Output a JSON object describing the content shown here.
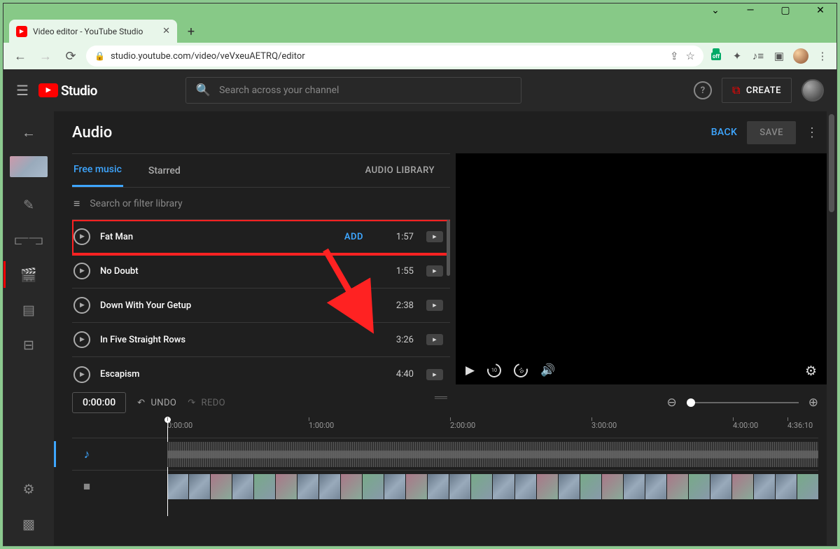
{
  "browser": {
    "tab_title": "Video editor - YouTube Studio",
    "url": "studio.youtube.com/video/veVxeuAETRQ/editor"
  },
  "studio": {
    "logo_text": "Studio",
    "search_placeholder": "Search across your channel",
    "create_label": "CREATE"
  },
  "page": {
    "title": "Audio",
    "back_label": "BACK",
    "save_label": "SAVE"
  },
  "tabs": {
    "free_music": "Free music",
    "starred": "Starred",
    "audio_library": "AUDIO LIBRARY"
  },
  "filter": {
    "placeholder": "Search or filter library"
  },
  "tracks": [
    {
      "title": "Fat Man",
      "duration": "1:57",
      "add": "ADD",
      "highlighted": true
    },
    {
      "title": "No Doubt",
      "duration": "1:55"
    },
    {
      "title": "Down With Your Getup",
      "duration": "2:38"
    },
    {
      "title": "In Five Straight Rows",
      "duration": "3:26"
    },
    {
      "title": "Escapism",
      "duration": "4:40"
    }
  ],
  "timeline": {
    "timecode": "0:00:00",
    "undo_label": "UNDO",
    "redo_label": "REDO",
    "ruler": [
      "0:00:00",
      "1:00:00",
      "2:00:00",
      "3:00:00",
      "4:00:00",
      "4:36:10"
    ]
  }
}
